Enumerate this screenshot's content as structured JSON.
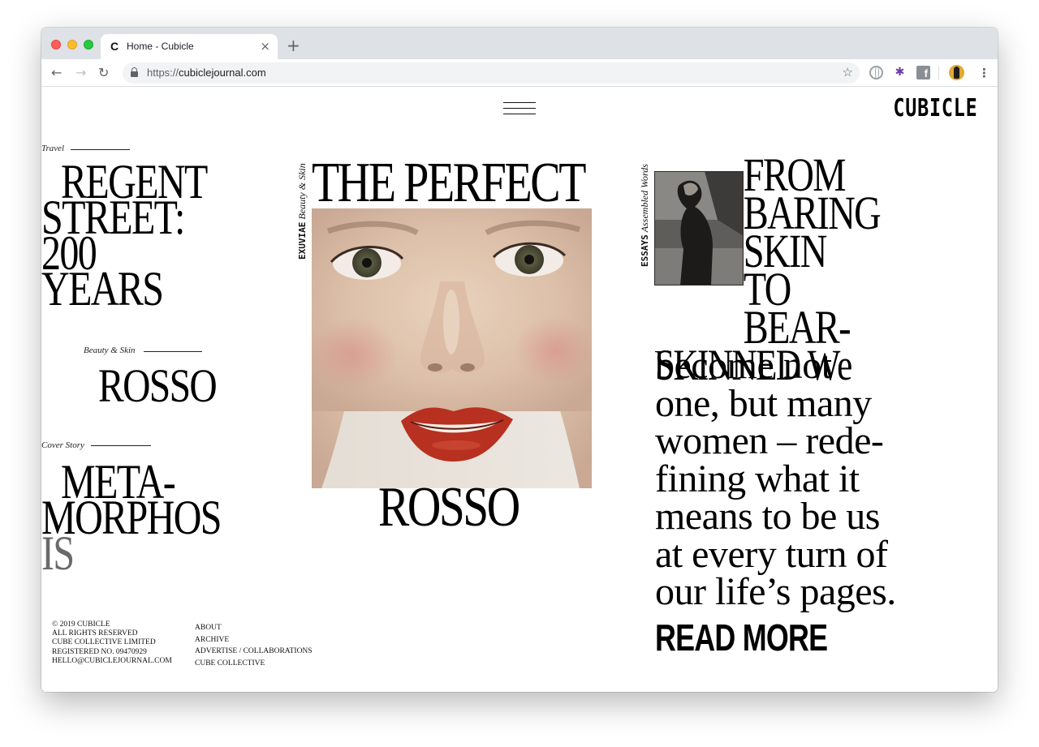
{
  "browser": {
    "tab_title": "Home - Cubicle",
    "tab_favicon": "C",
    "close_glyph": "×",
    "new_tab_glyph": "+",
    "url_scheme": "https://",
    "url_host": "cubiclejournal.com",
    "back_glyph": "←",
    "forward_glyph": "→",
    "reload_glyph": "↻",
    "star_glyph": "☆",
    "menu_glyph": "⋮",
    "ext_multi_glyph": "✱",
    "ext_fb_glyph": "f"
  },
  "site": {
    "brand": "CUBICLE"
  },
  "left_column": {
    "story1": {
      "kicker": "Travel",
      "title_lines": [
        "REGENT",
        "STREET:",
        "200",
        "YEARS"
      ]
    },
    "story2": {
      "kicker": "Beauty & Skin",
      "title": "ROSSO"
    },
    "story3": {
      "kicker": "Cover Story",
      "title_lines": [
        "META-",
        "MORPHOS",
        "IS"
      ]
    }
  },
  "center_column": {
    "tag_bold": "EXUVIAE",
    "tag_italic": "Beauty & Skin",
    "title_top": "THE PERFECT",
    "title_bottom": "ROSSO"
  },
  "right_column": {
    "tag_bold": "ESSAYS",
    "tag_italic": "Assembled Words",
    "title_lines_indented": [
      "FROM",
      "BARING",
      "SKIN TO",
      "BEAR-"
    ],
    "title_last_line": "SKINNED",
    "standfirst_lead": "We",
    "standfirst_lines": [
      "become not",
      "one, but many",
      "women – rede-",
      "fining what it",
      "means to be us",
      "at every turn of",
      "our life’s pages."
    ],
    "read_more": "READ MORE"
  },
  "footer": {
    "legal_lines": [
      "© 2019 CUBICLE",
      "ALL RIGHTS RESERVED",
      "CUBE COLLECTIVE LIMITED",
      "REGISTERED NO. 09470929",
      "HELLO@CUBICLEJOURNAL.COM"
    ],
    "links": [
      "ABOUT",
      "ARCHIVE",
      "ADVERTISE / COLLABORATIONS",
      "CUBE COLLECTIVE"
    ]
  },
  "colors": {
    "accent": "#000000",
    "tabstrip": "#dee1e6",
    "lip": "#b8301f"
  },
  "icons": [
    "lock-icon",
    "globe-extension-icon",
    "puzzle-extension-icon",
    "facebook-extension-icon",
    "profile-avatar-icon",
    "hamburger-menu-icon"
  ]
}
